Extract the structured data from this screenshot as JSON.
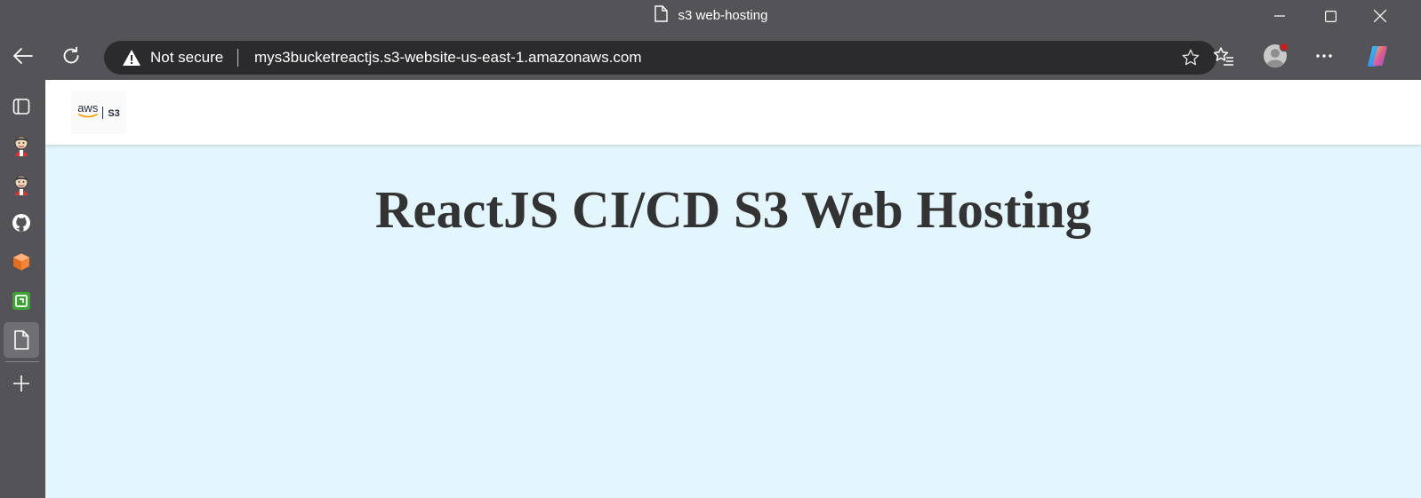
{
  "window": {
    "tab_title": "s3 web-hosting",
    "icons": {
      "page": "page-icon",
      "minimize": "minimize-icon",
      "maximize": "maximize-icon",
      "close": "close-icon"
    }
  },
  "toolbar": {
    "back_icon": "back-arrow-icon",
    "refresh_icon": "refresh-icon",
    "security_label": "Not secure",
    "url": "mys3bucketreactjs.s3-website-us-east-1.amazonaws.com",
    "favorite_icon": "star-icon",
    "favorites_icon": "favorites-icon",
    "profile_icon": "profile-avatar",
    "menu_icon": "more-icon",
    "copilot_icon": "copilot-icon"
  },
  "sidebar": {
    "items": [
      {
        "name": "tab-actions-icon"
      },
      {
        "name": "jenkins-icon"
      },
      {
        "name": "jenkins-icon"
      },
      {
        "name": "github-icon"
      },
      {
        "name": "aws-cube-icon"
      },
      {
        "name": "green-app-icon"
      },
      {
        "name": "document-icon",
        "active": true
      },
      {
        "name": "add-icon"
      }
    ]
  },
  "page": {
    "logo_text": "aws | S3",
    "heading": "ReactJS CI/CD S3 Web Hosting",
    "colors": {
      "background": "#e4f6fd",
      "header": "#ffffff",
      "heading": "#333333"
    }
  }
}
